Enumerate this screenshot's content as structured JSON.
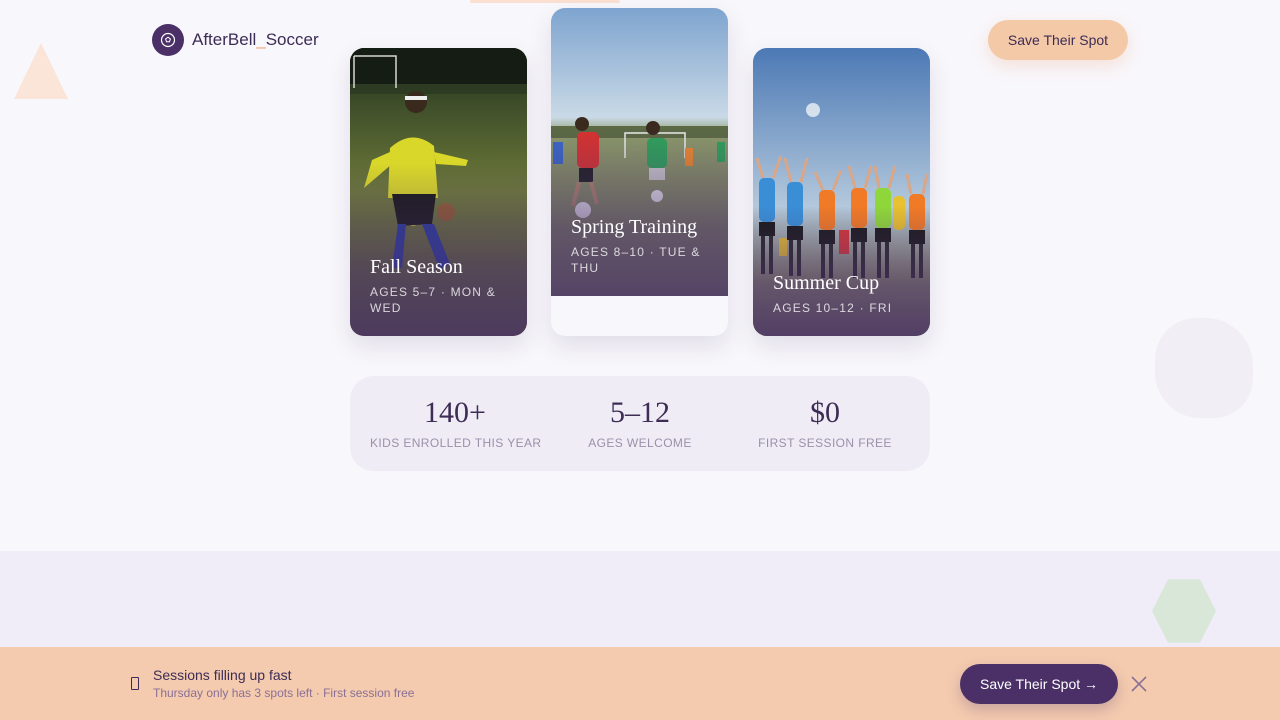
{
  "brand": {
    "name_part1": "AfterBell",
    "name_sep": "_",
    "name_part2": "Soccer",
    "logo_icon": "soccer-ball-icon"
  },
  "header": {
    "cta_label": "Save Their Spot"
  },
  "programs": [
    {
      "title": "Fall Season",
      "meta": "AGES 5–7 · MON & WED"
    },
    {
      "title": "Spring Training",
      "meta": "AGES 8–10 · TUE & THU"
    },
    {
      "title": "Summer Cup",
      "meta": "AGES 10–12 · FRI"
    }
  ],
  "stats": [
    {
      "value": "140+",
      "label": "KIDS ENROLLED THIS YEAR"
    },
    {
      "value": "5–12",
      "label": "AGES WELCOME"
    },
    {
      "value": "$0",
      "label": "FIRST SESSION FREE"
    }
  ],
  "notice": {
    "icon": "phone-icon",
    "title": "Sessions filling up fast",
    "subtitle": "Thursday only has 3 spots left · First session free",
    "cta_label": "Save Their Spot →",
    "close_icon": "close-icon"
  },
  "colors": {
    "brand": "#4a3066",
    "accent": "#f4c9a8",
    "background": "#f8f7fb"
  }
}
